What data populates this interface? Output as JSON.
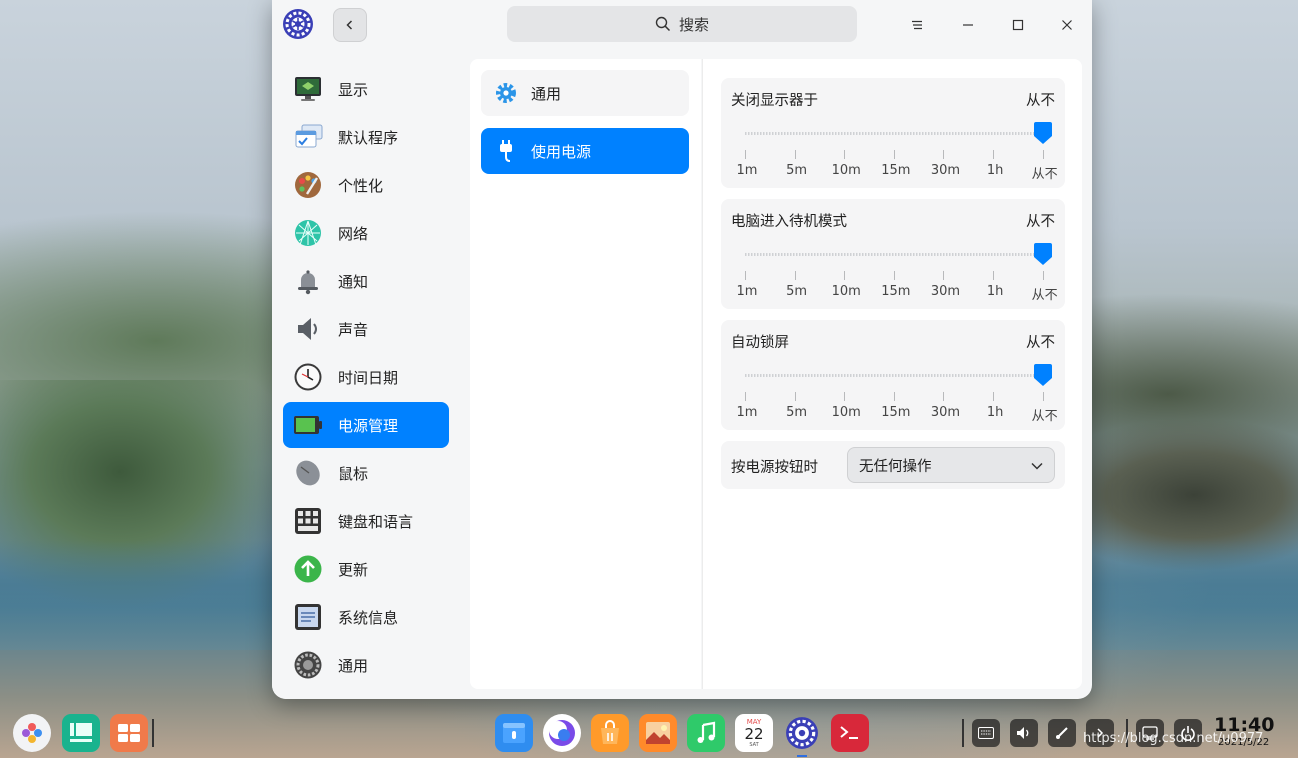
{
  "titlebar": {
    "search_placeholder": "搜索",
    "icons": [
      "control-center-logo",
      "back-icon",
      "search-icon",
      "menu-icon",
      "minimize-icon",
      "maximize-icon",
      "close-icon"
    ]
  },
  "sidebar": {
    "items": [
      {
        "label": "显示",
        "icon": "display-icon"
      },
      {
        "label": "默认程序",
        "icon": "default-apps-icon"
      },
      {
        "label": "个性化",
        "icon": "personalization-icon"
      },
      {
        "label": "网络",
        "icon": "network-icon"
      },
      {
        "label": "通知",
        "icon": "bell-icon"
      },
      {
        "label": "声音",
        "icon": "speaker-icon"
      },
      {
        "label": "时间日期",
        "icon": "clock-icon"
      },
      {
        "label": "电源管理",
        "icon": "battery-icon",
        "active": true
      },
      {
        "label": "鼠标",
        "icon": "mouse-icon"
      },
      {
        "label": "键盘和语言",
        "icon": "keyboard-icon"
      },
      {
        "label": "更新",
        "icon": "update-icon"
      },
      {
        "label": "系统信息",
        "icon": "system-info-icon"
      },
      {
        "label": "通用",
        "icon": "general-icon"
      }
    ]
  },
  "submenu": {
    "items": [
      {
        "label": "通用",
        "icon": "gear-icon"
      },
      {
        "label": "使用电源",
        "icon": "plug-icon",
        "active": true
      }
    ]
  },
  "settings": {
    "ticks": [
      "1m",
      "5m",
      "10m",
      "15m",
      "30m",
      "1h",
      "从不"
    ],
    "sliders": [
      {
        "title": "关闭显示器于",
        "value": "从不",
        "level": 1.0
      },
      {
        "title": "电脑进入待机模式",
        "value": "从不",
        "level": 1.0
      },
      {
        "title": "自动锁屏",
        "value": "从不",
        "level": 1.0
      }
    ],
    "power_button": {
      "label": "按电源按钮时",
      "selected": "无任何操作"
    }
  },
  "dock": {
    "left_apps": [
      "launcher-icon",
      "multitask-view-icon",
      "workspace-icon"
    ],
    "center_apps": [
      "file-manager-icon",
      "browser-icon",
      "app-store-icon",
      "image-viewer-icon",
      "music-icon",
      "calendar-icon",
      "control-center-icon",
      "terminal-icon"
    ],
    "calendar": {
      "month": "MAY",
      "day": "22",
      "weekday": "SAT"
    },
    "tray": [
      "onscreen-keyboard-icon",
      "volume-icon",
      "screenshot-icon",
      "expand-tray-icon",
      "notification-icon",
      "power-icon"
    ],
    "clock": {
      "time": "11:40",
      "date": "2021/5/22"
    }
  },
  "watermark": "https://blog.csdn.net/u0977"
}
